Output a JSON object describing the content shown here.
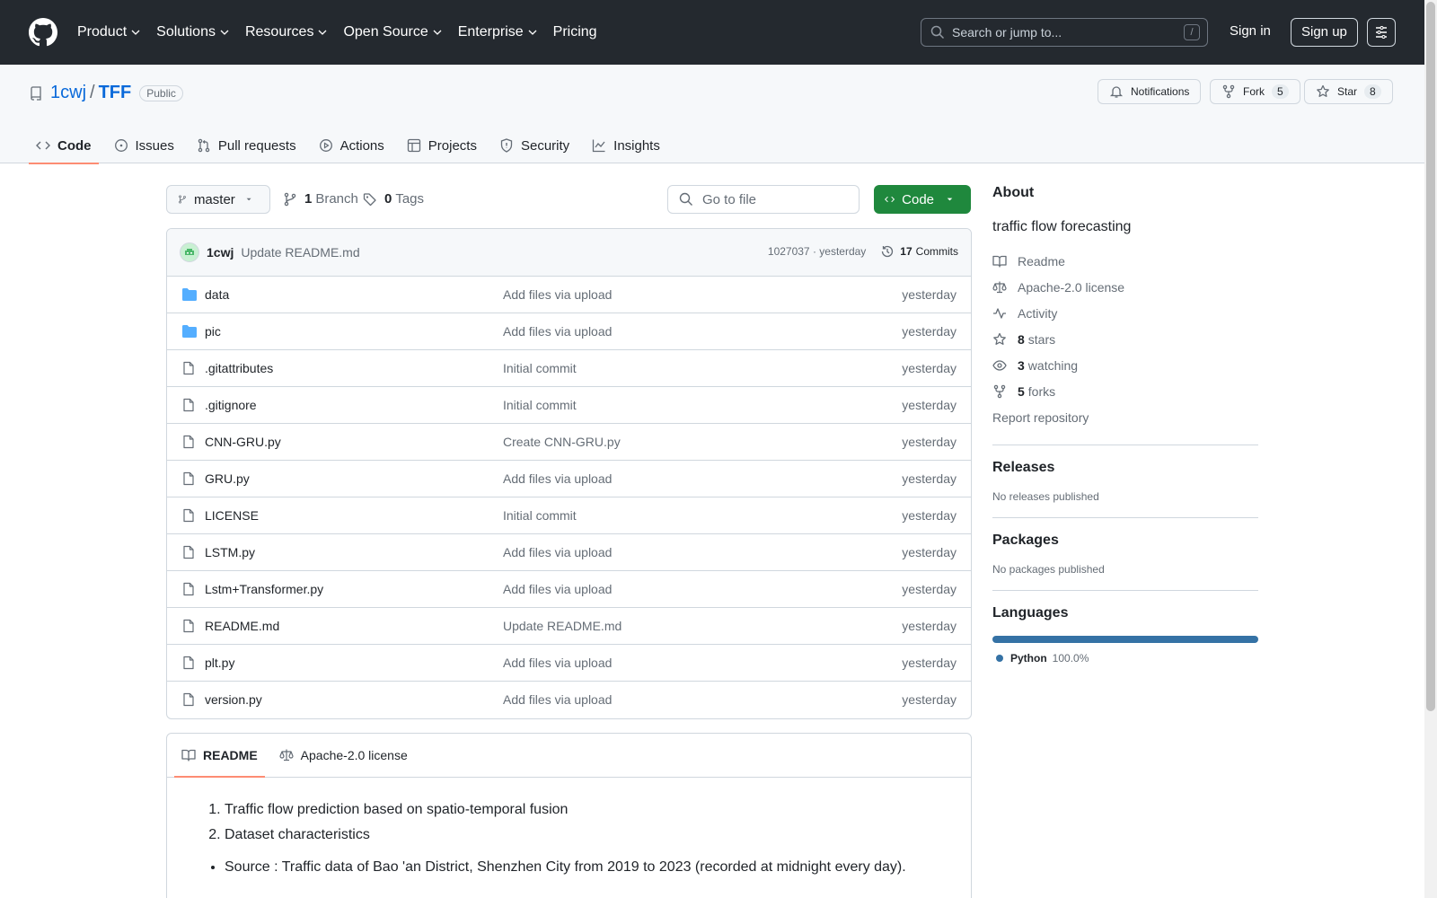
{
  "header": {
    "nav": [
      "Product",
      "Solutions",
      "Resources",
      "Open Source",
      "Enterprise",
      "Pricing"
    ],
    "search_placeholder": "Search or jump to...",
    "search_shortcut": "/",
    "signin": "Sign in",
    "signup": "Sign up"
  },
  "repo": {
    "owner": "1cwj",
    "separator": "/",
    "name": "TFF",
    "visibility": "Public",
    "notifications": "Notifications",
    "fork_label": "Fork",
    "fork_count": "5",
    "star_label": "Star",
    "star_count": "8"
  },
  "tabs": [
    "Code",
    "Issues",
    "Pull requests",
    "Actions",
    "Projects",
    "Security",
    "Insights"
  ],
  "toolbar": {
    "branch": "master",
    "branch_count": "1",
    "branch_label": "Branch",
    "tag_count": "0",
    "tag_label": "Tags",
    "goto_placeholder": "Go to file",
    "code_label": "Code"
  },
  "commit": {
    "author": "1cwj",
    "message": "Update README.md",
    "hash_time": "1027037 · yesterday",
    "commits_count": "17",
    "commits_label": "Commits"
  },
  "files": [
    {
      "name": "data",
      "type": "dir",
      "msg": "Add files via upload",
      "date": "yesterday"
    },
    {
      "name": "pic",
      "type": "dir",
      "msg": "Add files via upload",
      "date": "yesterday"
    },
    {
      "name": ".gitattributes",
      "type": "file",
      "msg": "Initial commit",
      "date": "yesterday"
    },
    {
      "name": ".gitignore",
      "type": "file",
      "msg": "Initial commit",
      "date": "yesterday"
    },
    {
      "name": "CNN-GRU.py",
      "type": "file",
      "msg": "Create CNN-GRU.py",
      "date": "yesterday"
    },
    {
      "name": "GRU.py",
      "type": "file",
      "msg": "Add files via upload",
      "date": "yesterday"
    },
    {
      "name": "LICENSE",
      "type": "file",
      "msg": "Initial commit",
      "date": "yesterday"
    },
    {
      "name": "LSTM.py",
      "type": "file",
      "msg": "Add files via upload",
      "date": "yesterday"
    },
    {
      "name": "Lstm+Transformer.py",
      "type": "file",
      "msg": "Add files via upload",
      "date": "yesterday"
    },
    {
      "name": "README.md",
      "type": "file",
      "msg": "Update README.md",
      "date": "yesterday"
    },
    {
      "name": "plt.py",
      "type": "file",
      "msg": "Add files via upload",
      "date": "yesterday"
    },
    {
      "name": "version.py",
      "type": "file",
      "msg": "Add files via upload",
      "date": "yesterday"
    }
  ],
  "readme": {
    "tab_readme": "README",
    "tab_license": "Apache-2.0 license",
    "ol": [
      "Traffic flow prediction based on spatio-temporal fusion",
      "Dataset characteristics"
    ],
    "ul": [
      "Source : Traffic data of Bao 'an District, Shenzhen City from 2019 to 2023 (recorded at midnight every day)."
    ]
  },
  "sidebar": {
    "about_title": "About",
    "description": "traffic flow forecasting",
    "readme": "Readme",
    "license": "Apache-2.0 license",
    "activity": "Activity",
    "stars_count": "8",
    "stars_label": "stars",
    "watching_count": "3",
    "watching_label": "watching",
    "forks_count": "5",
    "forks_label": "forks",
    "report": "Report repository",
    "releases_title": "Releases",
    "releases_text": "No releases published",
    "packages_title": "Packages",
    "packages_text": "No packages published",
    "languages_title": "Languages",
    "language": "Python",
    "language_pct": "100.0%",
    "language_fraction": 1.0
  },
  "colors": {
    "header_bg": "#24292f",
    "link": "#0969da",
    "code_button": "#1f883d",
    "tab_underline": "#fd8c73",
    "python": "#3572a5",
    "folder": "#54aeff"
  }
}
